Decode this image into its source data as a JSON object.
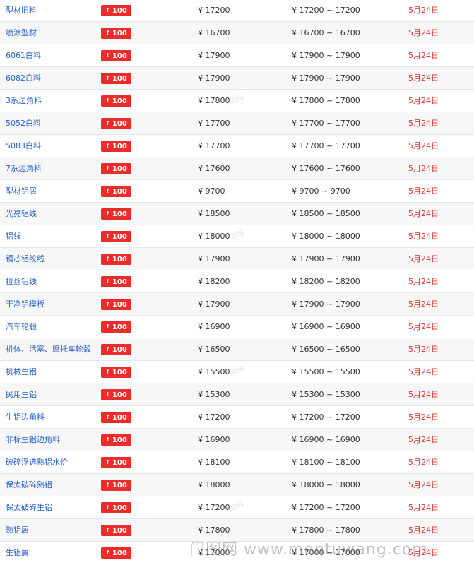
{
  "currency_symbol": "¥",
  "change_arrow": "↑",
  "colors": {
    "name_link": "#2a63c7",
    "badge_bg": "#ec2b2b",
    "date": "#e0302b",
    "row_alt": "#f7f7f7",
    "divider": "#e6e6e6"
  },
  "rows": [
    {
      "name": "型材旧料",
      "change": "100",
      "price": "¥ 17200",
      "range": "¥ 17200 ~ 17200",
      "date": "5月24日"
    },
    {
      "name": "喷涂型材",
      "change": "100",
      "price": "¥ 16700",
      "range": "¥ 16700 ~ 16700",
      "date": "5月24日"
    },
    {
      "name": "6061白料",
      "change": "100",
      "price": "¥ 17900",
      "range": "¥ 17900 ~ 17900",
      "date": "5月24日"
    },
    {
      "name": "6082白料",
      "change": "100",
      "price": "¥ 17900",
      "range": "¥ 17900 ~ 17900",
      "date": "5月24日"
    },
    {
      "name": "3系边角料",
      "change": "100",
      "price": "¥ 17800",
      "range": "¥ 17800 ~ 17800",
      "date": "5月24日"
    },
    {
      "name": "5052白料",
      "change": "100",
      "price": "¥ 17700",
      "range": "¥ 17700 ~ 17700",
      "date": "5月24日"
    },
    {
      "name": "5083白料",
      "change": "100",
      "price": "¥ 17700",
      "range": "¥ 17700 ~ 17700",
      "date": "5月24日"
    },
    {
      "name": "7系边角料",
      "change": "100",
      "price": "¥ 17600",
      "range": "¥ 17600 ~ 17600",
      "date": "5月24日"
    },
    {
      "name": "型材铝屑",
      "change": "100",
      "price": "¥ 9700",
      "range": "¥ 9700 ~ 9700",
      "date": "5月24日"
    },
    {
      "name": "光亮铝线",
      "change": "100",
      "price": "¥ 18500",
      "range": "¥ 18500 ~ 18500",
      "date": "5月24日"
    },
    {
      "name": "铝线",
      "change": "100",
      "price": "¥ 18000",
      "range": "¥ 18000 ~ 18000",
      "date": "5月24日"
    },
    {
      "name": "钢芯铝绞线",
      "change": "100",
      "price": "¥ 17900",
      "range": "¥ 17900 ~ 17900",
      "date": "5月24日"
    },
    {
      "name": "拉丝铝线",
      "change": "100",
      "price": "¥ 18200",
      "range": "¥ 18200 ~ 18200",
      "date": "5月24日"
    },
    {
      "name": "干净铝模板",
      "change": "100",
      "price": "¥ 17900",
      "range": "¥ 17900 ~ 17900",
      "date": "5月24日"
    },
    {
      "name": "汽车轮毂",
      "change": "100",
      "price": "¥ 16900",
      "range": "¥ 16900 ~ 16900",
      "date": "5月24日"
    },
    {
      "name": "机体、活塞、摩托车轮毂",
      "change": "100",
      "price": "¥ 16500",
      "range": "¥ 16500 ~ 16500",
      "date": "5月24日"
    },
    {
      "name": "机械生铝",
      "change": "100",
      "price": "¥ 15500",
      "range": "¥ 15500 ~ 15500",
      "date": "5月24日"
    },
    {
      "name": "民用生铝",
      "change": "100",
      "price": "¥ 15300",
      "range": "¥ 15300 ~ 15300",
      "date": "5月24日"
    },
    {
      "name": "生铝边角料",
      "change": "100",
      "price": "¥ 17200",
      "range": "¥ 17200 ~ 17200",
      "date": "5月24日"
    },
    {
      "name": "非标生铝边角料",
      "change": "100",
      "price": "¥ 16900",
      "range": "¥ 16900 ~ 16900",
      "date": "5月24日"
    },
    {
      "name": "破碎浮选熟铝水价",
      "change": "100",
      "price": "¥ 18100",
      "range": "¥ 18100 ~ 18100",
      "date": "5月24日"
    },
    {
      "name": "保太破碎熟铝",
      "change": "100",
      "price": "¥ 18000",
      "range": "¥ 18000 ~ 18000",
      "date": "5月24日"
    },
    {
      "name": "保太破碎生铝",
      "change": "100",
      "price": "¥ 17200",
      "range": "¥ 17200 ~ 17200",
      "date": "5月24日"
    },
    {
      "name": "熟铝屑",
      "change": "100",
      "price": "¥ 17800",
      "range": "¥ 17800 ~ 17800",
      "date": "5月24日"
    },
    {
      "name": "生铝屑",
      "change": "100",
      "price": "¥ 17000",
      "range": "¥ 17000 ~ 17000",
      "date": "5月24日"
    }
  ],
  "watermark": {
    "site": "门图网 www.mentuwang.com",
    "small": "大润网"
  }
}
